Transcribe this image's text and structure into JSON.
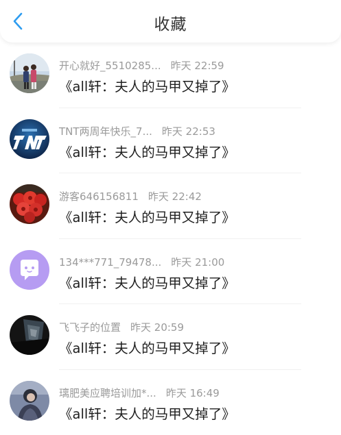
{
  "header": {
    "title": "收藏",
    "back_icon": "chevron-left-icon",
    "accent": "#2d9cf0"
  },
  "favorites": [
    {
      "user": "开心就好_5510285...",
      "time": "昨天 22:59",
      "book": "《all轩：夫人的马甲又掉了》",
      "avatar_icon": "photo-avatar-two-people"
    },
    {
      "user": "TNT两周年快乐_7...",
      "time": "昨天 22:53",
      "book": "《all轩：夫人的马甲又掉了》",
      "avatar_icon": "tnt-logo-avatar"
    },
    {
      "user": "游客646156811",
      "time": "昨天 22:42",
      "book": "《all轩：夫人的马甲又掉了》",
      "avatar_icon": "red-flowers-avatar"
    },
    {
      "user": "134***771_79478...",
      "time": "昨天 21:00",
      "book": "《all轩：夫人的马甲又掉了》",
      "avatar_icon": "chat-bubble-avatar"
    },
    {
      "user": "飞飞子的位置",
      "time": "昨天 20:59",
      "book": "《all轩：夫人的马甲又掉了》",
      "avatar_icon": "dark-photo-avatar"
    },
    {
      "user": "璃肥美应聘培训加*...",
      "time": "昨天 16:49",
      "book": "《all轩：夫人的马甲又掉了》",
      "avatar_icon": "portrait-avatar"
    }
  ]
}
